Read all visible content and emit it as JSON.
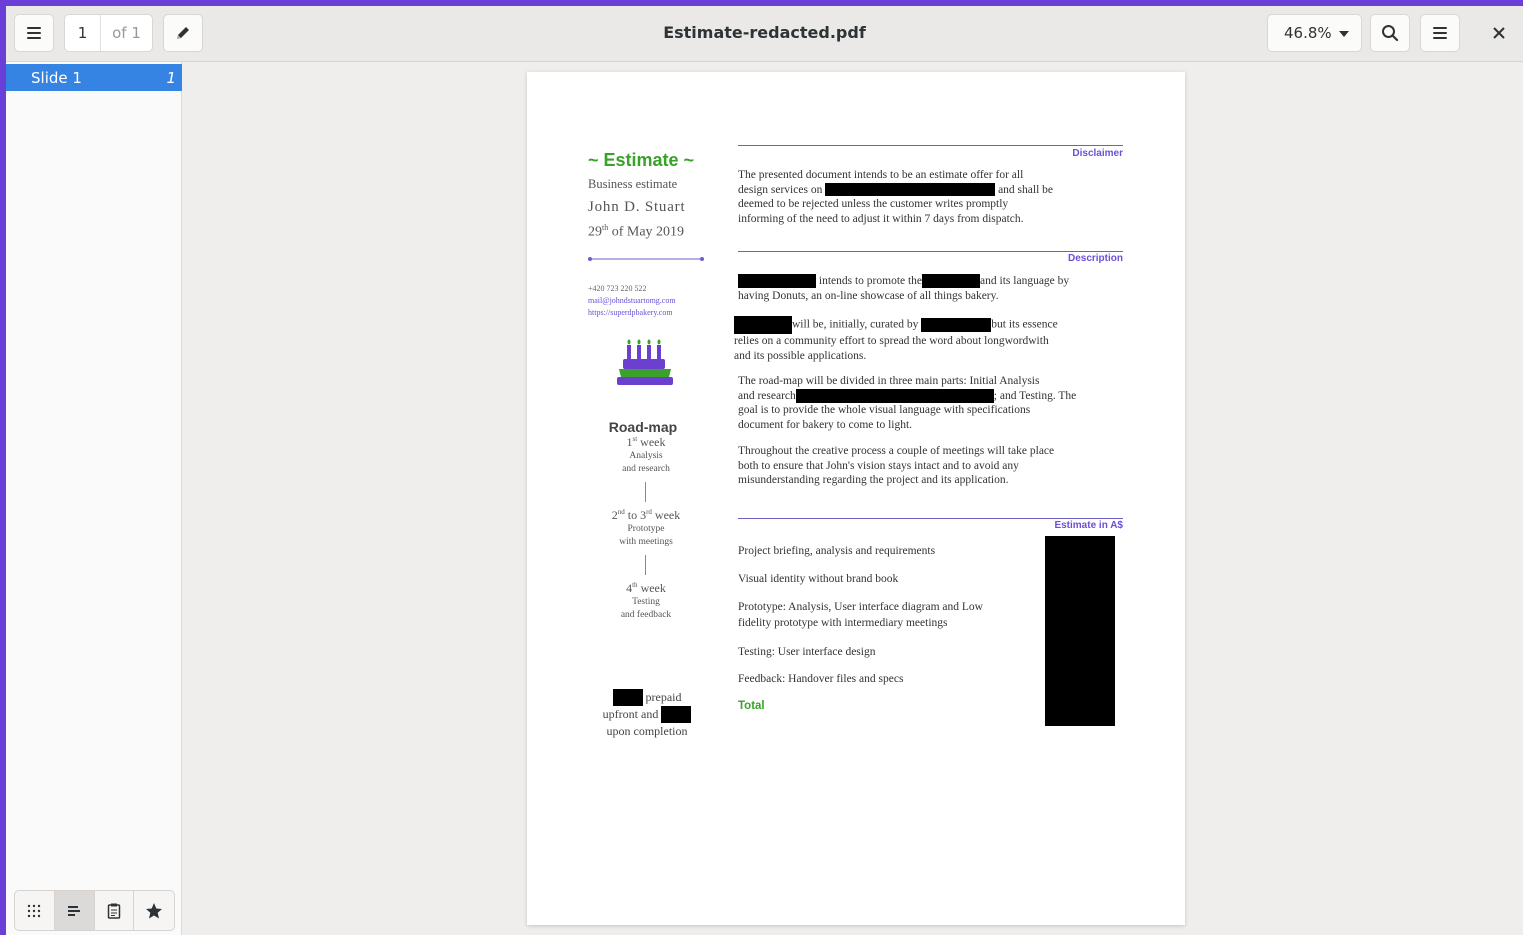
{
  "header": {
    "title": "Estimate-redacted.pdf",
    "page_current": "1",
    "page_total": "of 1",
    "zoom": "46.8%"
  },
  "sidebar": {
    "items": [
      {
        "label": "Slide 1",
        "num": "1"
      }
    ]
  },
  "doc": {
    "title": "~ Estimate ~",
    "subtitle": "Business estimate",
    "name": "John D. Stuart",
    "date_day": "29",
    "date_sup": "th",
    "date_rest": " of May 2019",
    "phone": "+420 723 220 522",
    "email": "mail@johndstuartomg.com",
    "web": "https://superdpbakery.com",
    "roadmap": {
      "head": "Road-map",
      "w1_num": "1",
      "w1_sup": "st",
      "w1_rest": " week",
      "w1_d1": "Analysis",
      "w1_d2": "and research",
      "w2_a": "2",
      "w2_asup": "nd",
      "w2_mid": " to 3",
      "w2_bsup": "rd",
      "w2_rest": " week",
      "w2_d1": "Prototype",
      "w2_d2": "with meetings",
      "w3_num": "4",
      "w3_sup": "th",
      "w3_rest": " week",
      "w3_d1": "Testing",
      "w3_d2": "and feedback"
    },
    "payment": {
      "l1": "prepaid",
      "l2": "upfront and",
      "l3": "upon completion"
    },
    "disclaimer_label": "Disclaimer",
    "disclaimer_p1a": "The presented document intends to be an estimate offer for all",
    "disclaimer_p1b": "design services on",
    "disclaimer_p1c": "and shall be",
    "disclaimer_p1d": "deemed to be rejected unless the customer writes promptly",
    "disclaimer_p1e": "informing of the need to adjust it within 7 days from dispatch.",
    "description_label": "Description",
    "desc1a": "intends to promote the",
    "desc1b": "and its language by",
    "desc1c": "having Donuts, an on-line showcase of all things bakery.",
    "desc2a": "will be, initially, curated by",
    "desc2b": "but its essence",
    "desc2c": "relies on a community effort to spread the word about longwordwith",
    "desc2d": "and its possible applications.",
    "desc3a": "The road-map will be divided in three main parts: Initial Analysis",
    "desc3b": "and research",
    "desc3c": "; and Testing. The",
    "desc3d": "goal is to provide the whole visual language with specifications",
    "desc3e": "document for bakery to come to light.",
    "desc4a": "Throughout the creative process a couple of meetings will take place",
    "desc4b": "both to ensure that John's vision stays intact and to avoid any",
    "desc4c": "misunderstanding regarding the project and its application.",
    "estimate_label": "Estimate in A$",
    "est_items": [
      "Project briefing, analysis and requirements",
      "Visual identity without brand book",
      "Prototype: Analysis, User interface diagram and Low",
      "fidelity prototype with intermediary meetings",
      "Testing: User interface design",
      "Feedback: Handover files and specs"
    ],
    "total": "Total"
  },
  "colors": {
    "accent": "#3584e4",
    "brand_green": "#3aa12a",
    "brand_purple": "#6b4fd8",
    "frame": "#6a3fd8"
  },
  "icons": [
    "sidebar-menu-icon",
    "pencil-icon",
    "search-icon",
    "menu-icon",
    "close-icon",
    "grid-icon",
    "outline-icon",
    "annotations-icon",
    "star-icon",
    "cake-icon"
  ]
}
